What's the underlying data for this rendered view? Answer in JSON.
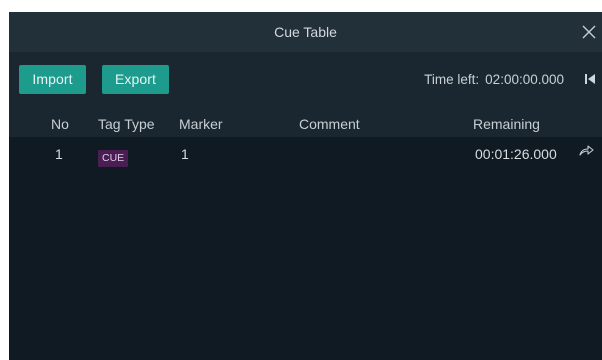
{
  "window": {
    "title": "Cue Table"
  },
  "toolbar": {
    "import_label": "Import",
    "export_label": "Export",
    "time_left_label": "Time left:",
    "time_left_value": "02:00:00.000"
  },
  "table": {
    "columns": [
      "No",
      "Tag Type",
      "Marker",
      "Comment",
      "Remaining"
    ],
    "rows": [
      {
        "no": "1",
        "tag_type": "CUE",
        "marker": "1",
        "comment": "",
        "remaining": "00:01:26.000"
      }
    ]
  },
  "icons": {
    "close": "close-icon",
    "skip": "skip-to-start-icon",
    "jump": "jump-arrow-icon"
  },
  "colors": {
    "accent": "#1d9b8d",
    "cue_badge": "#4a1e52",
    "background": "#0f1a23"
  }
}
